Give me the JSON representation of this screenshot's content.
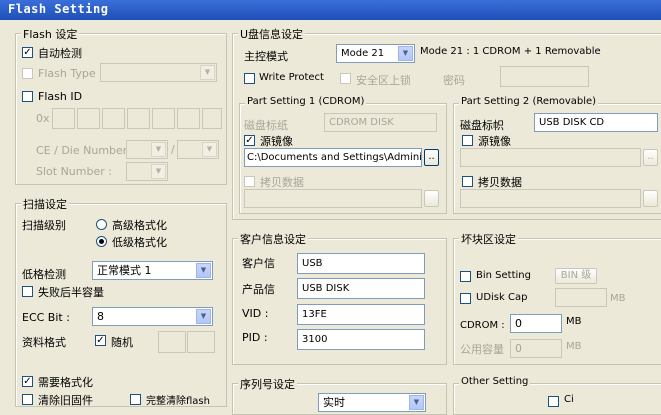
{
  "window": {
    "title": "Flash Setting"
  },
  "flash_group": {
    "title": "Flash 设定",
    "auto_detect": {
      "label": "自动检测",
      "checked": true
    },
    "flash_type": {
      "label": "Flash Type",
      "checked": false,
      "value": ""
    },
    "flash_id": {
      "label": "Flash ID",
      "checked": false,
      "prefix": "0x"
    },
    "ce_die_label": "CE / Die Number :",
    "slot_label": "Slot Number :"
  },
  "scan_group": {
    "title": "扫描设定",
    "scan_level_label": "扫描级别",
    "high_format": {
      "label": "高级格式化",
      "selected": false
    },
    "low_format": {
      "label": "低级格式化",
      "selected": true
    },
    "low_test_label": "低格检测",
    "low_test_value": "正常模式 1",
    "half_capacity": {
      "label": "失败后半容量",
      "checked": false
    },
    "ecc_label": "ECC Bit :",
    "ecc_value": "8",
    "data_format_label": "资料格式",
    "random": {
      "label": "随机",
      "checked": true
    },
    "need_format": {
      "label": "需要格式化",
      "checked": true
    },
    "clear_firmware": {
      "label": "清除旧固件",
      "checked": false
    },
    "full_erase": {
      "label": "完整清除flash",
      "checked": false
    }
  },
  "udisk_group": {
    "title": "U盘信息设定",
    "master_mode_label": "主控模式",
    "master_mode_value": "Mode 21",
    "master_mode_desc": "Mode 21 : 1 CDROM + 1 Removable",
    "write_protect": {
      "label": "Write Protect",
      "checked": false
    },
    "secure_lock": {
      "label": "安全区上锁",
      "checked": false
    },
    "password_label": "密码"
  },
  "part1": {
    "title": "Part Setting 1 (CDROM)",
    "disk_label_label": "磁盘标纸",
    "disk_label_value": "CDROM DISK",
    "source_image": {
      "label": "源镜像",
      "checked": true
    },
    "source_path": "C:\\Documents and Settings\\Administ",
    "browse": "..",
    "copy_data": {
      "label": "拷贝数据",
      "checked": false
    }
  },
  "part2": {
    "title": "Part Setting 2 (Removable)",
    "disk_label_label": "磁盘标帜",
    "disk_label_value": "USB DISK CD",
    "source_image": {
      "label": "源镜像",
      "checked": false
    },
    "browse": "..",
    "copy_data": {
      "label": "拷贝数据",
      "checked": false
    }
  },
  "customer_group": {
    "title": "客户信息设定",
    "customer_label": "客户信",
    "customer_value": "USB",
    "product_label": "产品信",
    "product_value": "USB DISK",
    "vid_label": "VID :",
    "vid_value": "13FE",
    "pid_label": "PID :",
    "pid_value": "3100"
  },
  "bad_block_group": {
    "title": "坏块区设定",
    "bin_setting": {
      "label": "Bin Setting",
      "checked": false
    },
    "bin_level": "BIN 级",
    "udisk_cap": {
      "label": "UDisk Cap",
      "checked": false
    },
    "udisk_cap_unit": "MB",
    "cdrom_label": "CDROM :",
    "cdrom_value": "0",
    "cdrom_unit": "MB",
    "public_cap_label": "公用容量",
    "public_cap_value": "0",
    "public_cap_unit": "MB"
  },
  "serial_group": {
    "title": "序列号设定",
    "value": "实时"
  },
  "other_group": {
    "title": "Other Setting",
    "first_item": "Ci"
  }
}
